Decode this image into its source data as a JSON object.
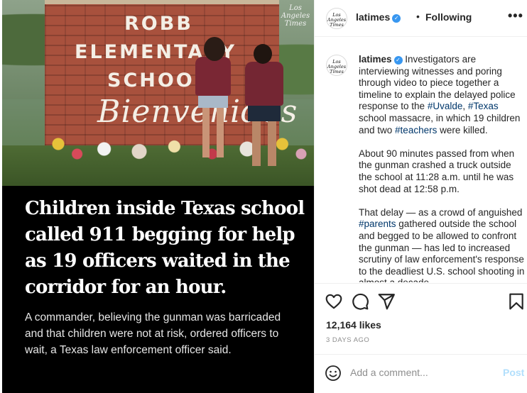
{
  "image_overlay": {
    "sign_line1": "ROBB",
    "sign_line2": "ELEMENTARY",
    "sign_line3": "SCHOOL",
    "sign_script": "Bienvenidos",
    "watermark": "Los Angeles Times"
  },
  "headline": "Children inside Texas school called 911 begging for help as 19 officers waited in the corridor for an hour.",
  "dek": "A commander, believing the gunman was barricaded and that children were not at risk, ordered officers to wait, a Texas law enforcement officer said.",
  "header": {
    "avatar_text": "Los Angeles Times",
    "username": "latimes",
    "verified_mark": "✓",
    "separator": "•",
    "follow_status": "Following",
    "more_icon": "•••"
  },
  "caption": {
    "avatar_text": "Los Angeles Times",
    "username": "latimes",
    "verified_mark": "✓",
    "p1_part1": " Investigators are interviewing witnesses and poring through video to piece together a timeline to explain the delayed police response to the ",
    "p1_tag1": "#Uvalde",
    "p1_part2": ", ",
    "p1_tag2": "#Texas",
    "p1_part3": " school massacre, in which 19 children and two ",
    "p1_tag3": "#teachers",
    "p1_part4": " were killed.",
    "p2": "About 90 minutes passed from when the gunman crashed a truck outside the school at 11:28 a.m. until he was shot dead at 12:58 p.m.",
    "p3_part1": "That delay — as a crowd of anguished ",
    "p3_tag1": "#parents",
    "p3_part2": " gathered outside the school and begged to be allowed to confront the gunman — has led to increased scrutiny of law enforcement's response to the deadliest U.S. school shooting in almost a decade."
  },
  "actions": {
    "like_icon": "heart-icon",
    "comment_icon": "comment-bubble-icon",
    "share_icon": "paper-plane-icon",
    "save_icon": "bookmark-icon",
    "likes_label": "12,164 likes",
    "timestamp": "3 DAYS AGO"
  },
  "comment": {
    "emoji_icon": "smiley-icon",
    "placeholder": "Add a comment...",
    "post_label": "Post"
  },
  "colors": {
    "hashtag": "#00376b",
    "verified": "#3897f0",
    "post_disabled": "#b2dffc",
    "muted": "#8e8e8e"
  }
}
